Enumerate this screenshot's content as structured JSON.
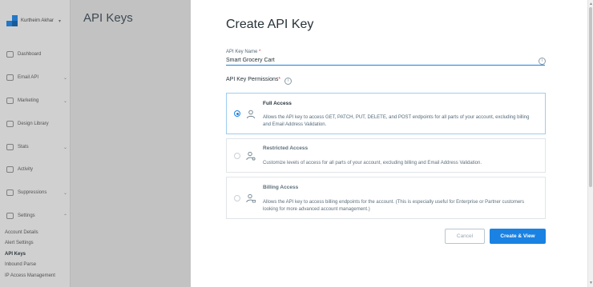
{
  "sidebar": {
    "account_name": "Kurtheim Akhar",
    "nav": [
      {
        "label": "Dashboard",
        "chevron": false
      },
      {
        "label": "Email API",
        "chevron": true
      },
      {
        "label": "Marketing",
        "chevron": true
      },
      {
        "label": "Design Library",
        "chevron": false
      },
      {
        "label": "Stats",
        "chevron": true
      },
      {
        "label": "Activity",
        "chevron": false
      },
      {
        "label": "Suppressions",
        "chevron": true
      },
      {
        "label": "Settings",
        "chevron": true
      }
    ],
    "sub_items": [
      "Account Details",
      "Alert Settings",
      "API Keys",
      "Inbound Parse",
      "IP Access Management"
    ]
  },
  "page": {
    "title": "API Keys"
  },
  "modal": {
    "title": "Create API Key",
    "name_label": "API Key Name",
    "required_mark": "*",
    "name_value": "Smart Grocery Cart",
    "permissions_label": "API Key Permissions",
    "options": [
      {
        "title": "Full Access",
        "description": "Allows the API key to access GET, PATCH, PUT, DELETE, and POST endpoints for all parts of your account, excluding billing and Email Address Validation.",
        "selected": true
      },
      {
        "title": "Restricted Access",
        "description": "Customize levels of access for all parts of your account, excluding billing and Email Address Validation.",
        "selected": false
      },
      {
        "title": "Billing Access",
        "description": "Allows the API key to access billing endpoints for the account. (This is especially useful for Enterprise or Partner customers looking for more advanced account management.)",
        "selected": false
      }
    ],
    "cancel_label": "Cancel",
    "create_label": "Create & View"
  },
  "colors": {
    "accent": "#1a82e2",
    "required": "#f22f46",
    "selected_border": "#9ccdf1"
  },
  "icons": [
    "info-icon",
    "user-icon",
    "user-settings-icon",
    "user-billing-icon",
    "chevron-down-icon"
  ]
}
